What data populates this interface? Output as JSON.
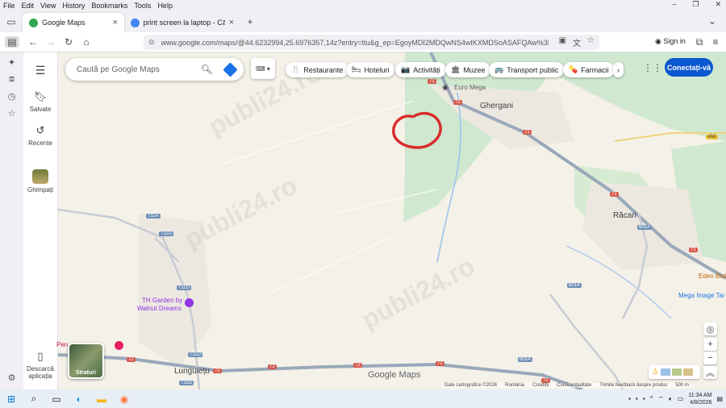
{
  "menubar": {
    "items": [
      "File",
      "Edit",
      "View",
      "History",
      "Bookmarks",
      "Tools",
      "Help"
    ],
    "win": [
      "–",
      "❐",
      "✕"
    ]
  },
  "tabs": [
    {
      "title": "Google Maps",
      "active": true
    },
    {
      "title": "print screen la laptop - Căutare",
      "active": false
    }
  ],
  "new_tab": "+",
  "urlbar": {
    "url": "www.google.com/maps/@44.6232994,25.6976357,14z?entry=ttu&g_ep=EgoyMDI2MDQwNS4wIKXMDSoASAFQAw%3D%3D",
    "signin": "Sign in"
  },
  "gm_rail": {
    "saved": "Salvate",
    "recent": "Recente",
    "guess": "Ghimpați",
    "download": "Descarcă aplicația"
  },
  "search": {
    "placeholder": "Caută pe Google Maps"
  },
  "chips": [
    {
      "icon": "🍴",
      "label": "Restaurante"
    },
    {
      "icon": "🛏",
      "label": "Hoteluri"
    },
    {
      "icon": "📷",
      "label": "Activități"
    },
    {
      "icon": "🏛",
      "label": "Muzee"
    },
    {
      "icon": "🚌",
      "label": "Transport public"
    },
    {
      "icon": "💊",
      "label": "Farmacii"
    }
  ],
  "signin_btn": "Conectați-vă",
  "map_labels": {
    "euro_mega": "Euro Mega",
    "ghergani": "Ghergani",
    "racari": "Răcari",
    "eden": "Eden Bist",
    "mega_image": "Mega Image Tar",
    "th_garden_1": "TH Garden by",
    "th_garden_2": "Walnut Dreams",
    "lungulet": "Lungulețu",
    "pen": "Pen"
  },
  "road_shields": {
    "r711a": "711A",
    "r711d": "711D",
    "r71": "71",
    "r601a": "601A",
    "r43a": "43A",
    "r72": "72"
  },
  "strata": "Straturi",
  "watermark": "publi24.ro",
  "logo": "Google Maps",
  "attribution": [
    "Date cartografice ©2026",
    "România",
    "Condiții",
    "Confidențialitate",
    "Trimite feedback despre produs",
    "500 m"
  ],
  "clock": {
    "time": "11:34 AM",
    "date": "4/8/2026"
  }
}
